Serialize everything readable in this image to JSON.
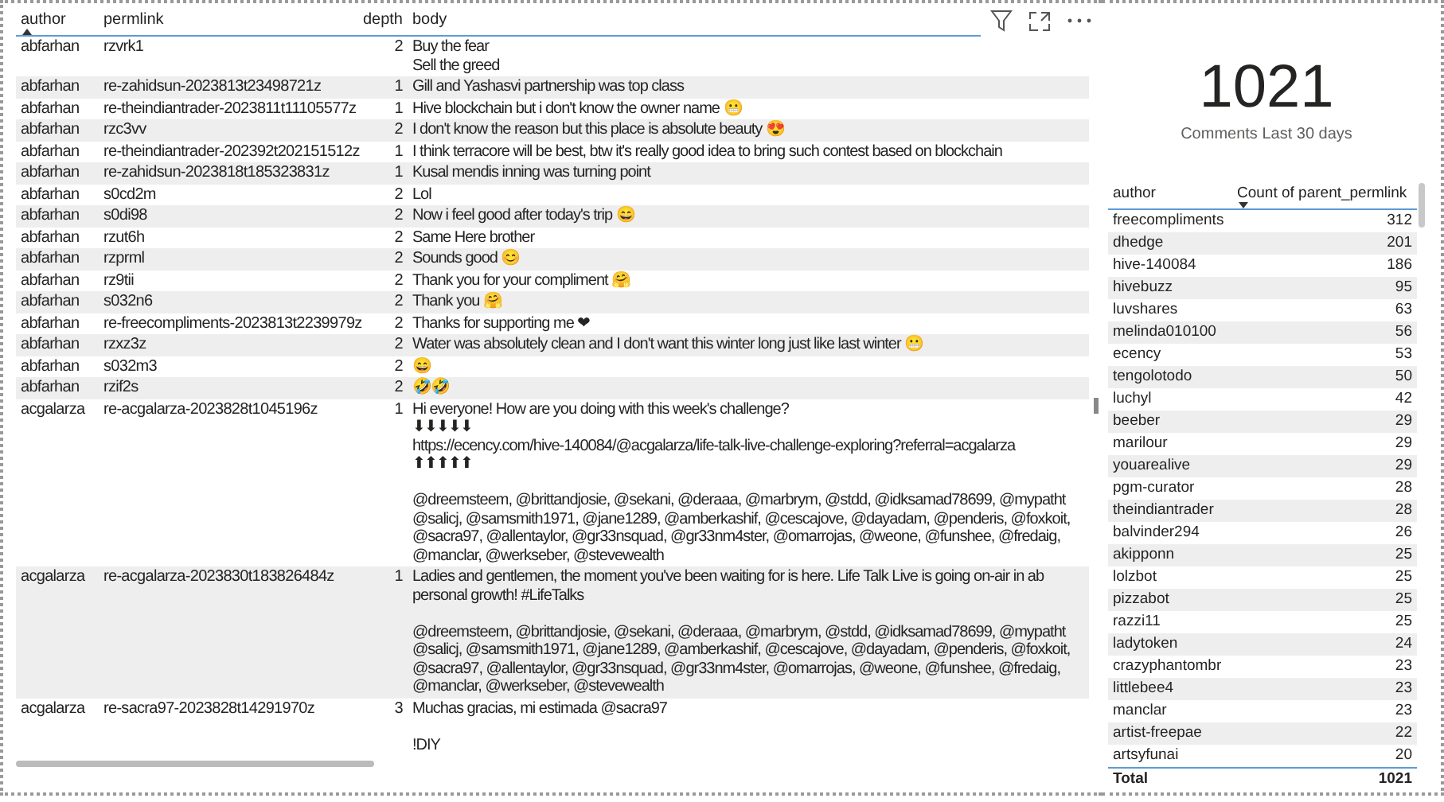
{
  "comments_table": {
    "columns": [
      {
        "label": "author",
        "sort_ascending": true
      },
      {
        "label": "permlink"
      },
      {
        "label": "depth"
      },
      {
        "label": "body"
      }
    ],
    "rows": [
      {
        "author": "abfarhan",
        "permlink": "rzvrk1",
        "depth": "2",
        "body": [
          "Buy the fear",
          "Sell the greed"
        ]
      },
      {
        "author": "abfarhan",
        "permlink": "re-zahidsun-2023813t23498721z",
        "depth": "1",
        "body": [
          "Gill and Yashasvi partnership was top class"
        ]
      },
      {
        "author": "abfarhan",
        "permlink": "re-theindiantrader-2023811t11105577z",
        "depth": "1",
        "body": [
          "Hive blockchain but i don't know the owner name 😬"
        ]
      },
      {
        "author": "abfarhan",
        "permlink": "rzc3vv",
        "depth": "2",
        "body": [
          "I don't know the reason but this place is absolute beauty 😍"
        ]
      },
      {
        "author": "abfarhan",
        "permlink": "re-theindiantrader-202392t202151512z",
        "depth": "1",
        "body": [
          "I think terracore will be best, btw it's really good idea to bring such contest based on blockchain"
        ]
      },
      {
        "author": "abfarhan",
        "permlink": "re-zahidsun-2023818t185323831z",
        "depth": "1",
        "body": [
          "Kusal mendis inning was turning point"
        ]
      },
      {
        "author": "abfarhan",
        "permlink": "s0cd2m",
        "depth": "2",
        "body": [
          "Lol"
        ]
      },
      {
        "author": "abfarhan",
        "permlink": "s0di98",
        "depth": "2",
        "body": [
          "Now i feel good after today's trip 😄"
        ]
      },
      {
        "author": "abfarhan",
        "permlink": "rzut6h",
        "depth": "2",
        "body": [
          "Same Here brother"
        ]
      },
      {
        "author": "abfarhan",
        "permlink": "rzprml",
        "depth": "2",
        "body": [
          "Sounds good 😊"
        ]
      },
      {
        "author": "abfarhan",
        "permlink": "rz9tii",
        "depth": "2",
        "body": [
          "Thank you for your compliment 🤗"
        ]
      },
      {
        "author": "abfarhan",
        "permlink": "s032n6",
        "depth": "2",
        "body": [
          "Thank you 🤗"
        ]
      },
      {
        "author": "abfarhan",
        "permlink": "re-freecompliments-2023813t2239979z",
        "depth": "2",
        "body": [
          "Thanks for supporting me ❤"
        ]
      },
      {
        "author": "abfarhan",
        "permlink": "rzxz3z",
        "depth": "2",
        "body": [
          "Water was absolutely clean and I don't want this winter long just like last winter 😬"
        ]
      },
      {
        "author": "abfarhan",
        "permlink": "s032m3",
        "depth": "2",
        "body": [
          "😄"
        ]
      },
      {
        "author": "abfarhan",
        "permlink": "rzif2s",
        "depth": "2",
        "body": [
          "🤣🤣"
        ]
      },
      {
        "author": "acgalarza",
        "permlink": "re-acgalarza-2023828t1045196z",
        "depth": "1",
        "body": [
          [
            "Hi everyone! How are you doing with this week's challenge?",
            "⬇⬇⬇⬇⬇",
            "https://ecency.com/hive-140084/@acgalarza/life-talk-live-challenge-exploring?referral=acgalarza",
            "⬆⬆⬆⬆⬆"
          ],
          [
            "@dreemsteem, @brittandjosie, @sekani, @deraaa, @marbrym, @stdd, @idksamad78699, @mypatht",
            "@salicj, @samsmith1971, @jane1289, @amberkashif, @cescajove, @dayadam, @penderis, @foxkoit,",
            "@sacra97, @allentaylor, @gr33nsquad, @gr33nm4ster, @omarrojas, @weone, @funshee, @fredaig,",
            "@manclar, @werkseber, @stevewealth"
          ]
        ]
      },
      {
        "author": "acgalarza",
        "permlink": "re-acgalarza-2023830t183826484z",
        "depth": "1",
        "body": [
          [
            "Ladies and gentlemen, the moment you've been waiting for is here. Life Talk Live is going on-air in ab",
            "personal growth! #LifeTalks"
          ],
          [
            "@dreemsteem, @brittandjosie, @sekani, @deraaa, @marbrym, @stdd, @idksamad78699, @mypatht",
            "@salicj, @samsmith1971, @jane1289, @amberkashif, @cescajove, @dayadam, @penderis, @foxkoit,",
            "@sacra97, @allentaylor, @gr33nsquad, @gr33nm4ster, @omarrojas, @weone, @funshee, @fredaig,",
            "@manclar, @werkseber, @stevewealth"
          ]
        ]
      },
      {
        "author": "acgalarza",
        "permlink": "re-sacra97-2023828t14291970z",
        "depth": "3",
        "body": [
          [
            "Muchas gracias, mi estimada @sacra97"
          ],
          [
            "!DIY"
          ]
        ]
      }
    ]
  },
  "kpi_card": {
    "value": "1021",
    "label": "Comments Last 30 days"
  },
  "author_table": {
    "columns": [
      {
        "label": "author"
      },
      {
        "label": "Count of parent_permlink",
        "sort_descending": true
      }
    ],
    "rows": [
      {
        "author": "freecompliments",
        "count": "312"
      },
      {
        "author": "dhedge",
        "count": "201"
      },
      {
        "author": "hive-140084",
        "count": "186"
      },
      {
        "author": "hivebuzz",
        "count": "95"
      },
      {
        "author": "luvshares",
        "count": "63"
      },
      {
        "author": "melinda010100",
        "count": "56"
      },
      {
        "author": "ecency",
        "count": "53"
      },
      {
        "author": "tengolotodo",
        "count": "50"
      },
      {
        "author": "luchyl",
        "count": "42"
      },
      {
        "author": "beeber",
        "count": "29"
      },
      {
        "author": "marilour",
        "count": "29"
      },
      {
        "author": "youarealive",
        "count": "29"
      },
      {
        "author": "pgm-curator",
        "count": "28"
      },
      {
        "author": "theindiantrader",
        "count": "28"
      },
      {
        "author": "balvinder294",
        "count": "26"
      },
      {
        "author": "akipponn",
        "count": "25"
      },
      {
        "author": "lolzbot",
        "count": "25"
      },
      {
        "author": "pizzabot",
        "count": "25"
      },
      {
        "author": "razzi11",
        "count": "25"
      },
      {
        "author": "ladytoken",
        "count": "24"
      },
      {
        "author": "crazyphantombr",
        "count": "23"
      },
      {
        "author": "littlebee4",
        "count": "23"
      },
      {
        "author": "manclar",
        "count": "23"
      },
      {
        "author": "artist-freepae",
        "count": "22"
      },
      {
        "author": "artsyfunai",
        "count": "20"
      }
    ],
    "total": {
      "label": "Total",
      "value": "1021"
    }
  }
}
